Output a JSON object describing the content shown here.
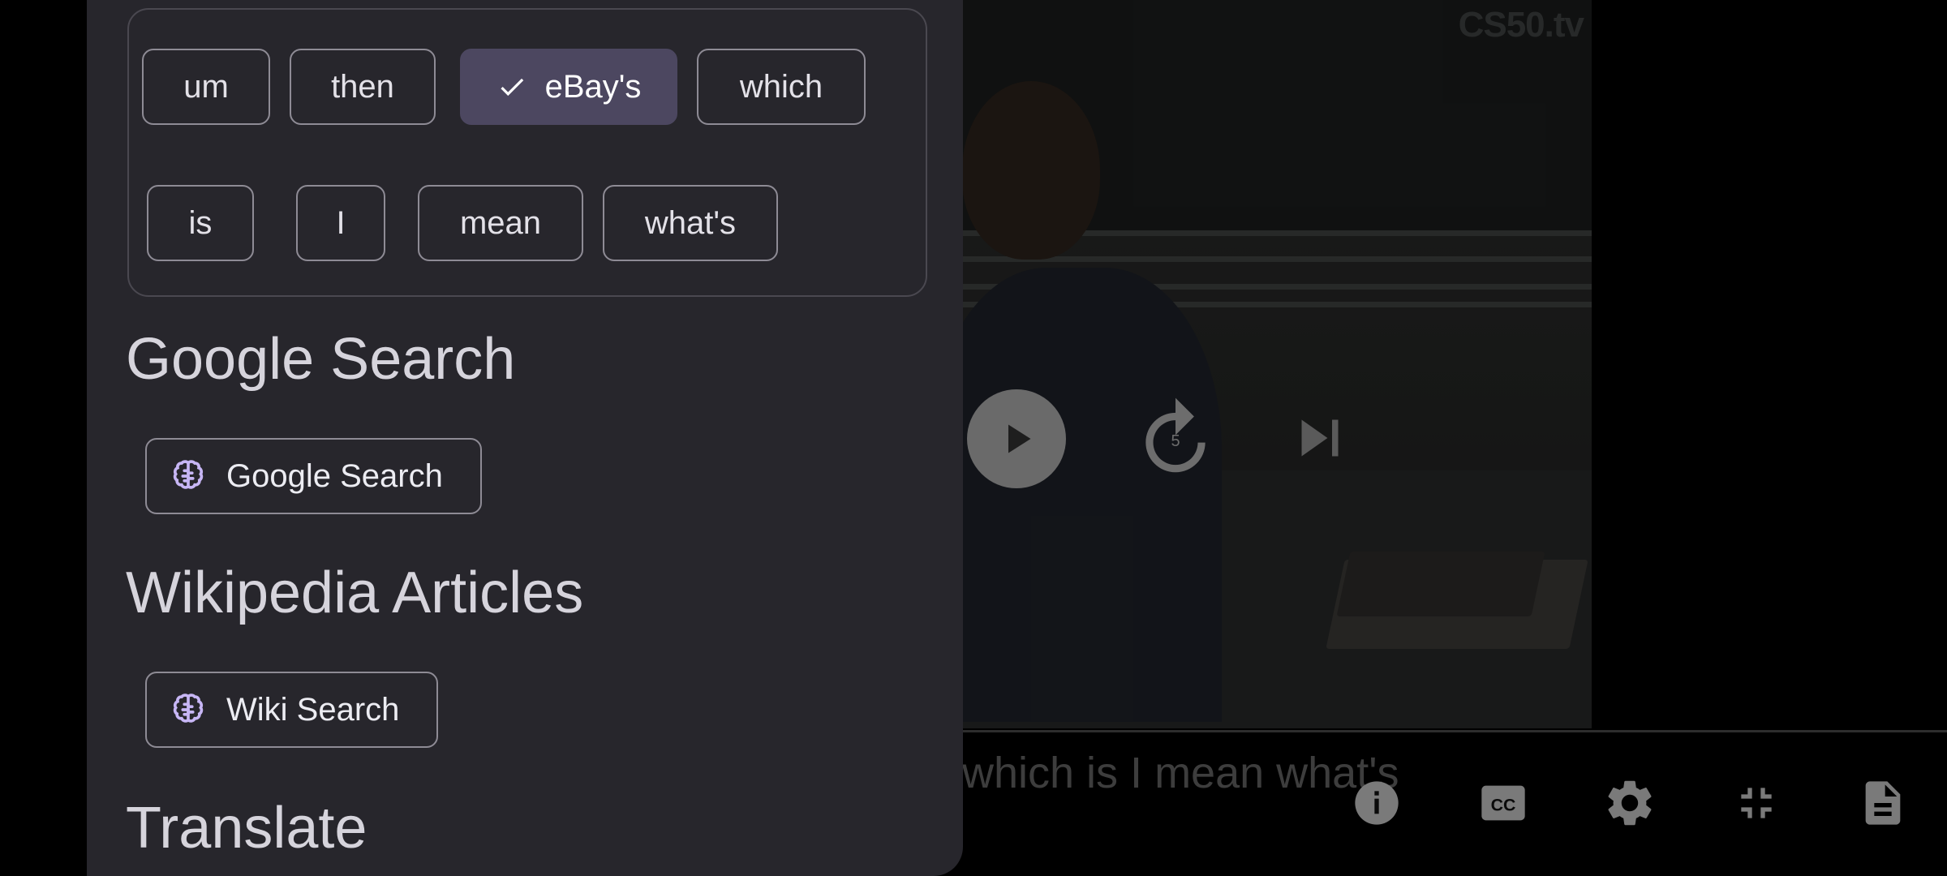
{
  "video": {
    "watermark": "CS50.tv",
    "subtitle": "which is I mean what's",
    "replay_seconds": "5"
  },
  "controls": {
    "play": "play-icon",
    "replay": "replay-5-icon",
    "next": "skip-next-icon"
  },
  "toolbar": [
    "info-icon",
    "closed-caption-icon",
    "settings-icon",
    "exit-fullscreen-icon",
    "notes-icon"
  ],
  "panel": {
    "word_chips": [
      {
        "label": "um",
        "selected": false
      },
      {
        "label": "then",
        "selected": false
      },
      {
        "label": "eBay's",
        "selected": true
      },
      {
        "label": "which",
        "selected": false
      },
      {
        "label": "is",
        "selected": false
      },
      {
        "label": "I",
        "selected": false
      },
      {
        "label": "mean",
        "selected": false
      },
      {
        "label": "what's",
        "selected": false
      }
    ],
    "google": {
      "heading": "Google Search",
      "button_label": "Google Search"
    },
    "wiki": {
      "heading": "Wikipedia Articles",
      "button_label": "Wiki Search"
    },
    "translate": {
      "heading": "Translate"
    }
  },
  "colors": {
    "panel_bg": "#27262c",
    "chip_selected": "#4c4760",
    "brain_icon": "#c7b6f5"
  }
}
